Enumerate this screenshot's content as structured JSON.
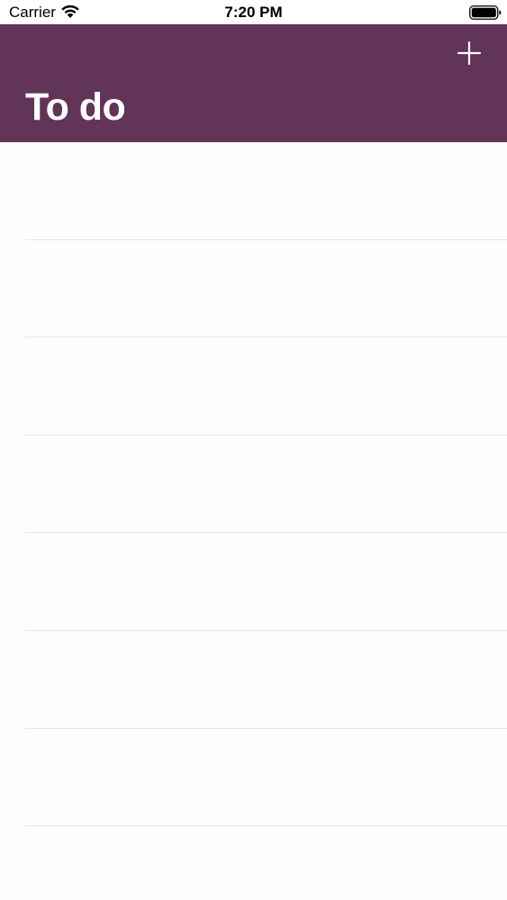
{
  "status_bar": {
    "carrier": "Carrier",
    "time": "7:20 PM",
    "wifi_icon": "wifi-icon",
    "battery_icon": "battery-full-icon"
  },
  "nav_bar": {
    "title": "To do",
    "add_icon": "plus-icon",
    "background_color": "#623457"
  },
  "todo_list": {
    "rows": [
      {
        "text": ""
      },
      {
        "text": ""
      },
      {
        "text": ""
      },
      {
        "text": ""
      },
      {
        "text": ""
      },
      {
        "text": ""
      },
      {
        "text": ""
      }
    ]
  }
}
